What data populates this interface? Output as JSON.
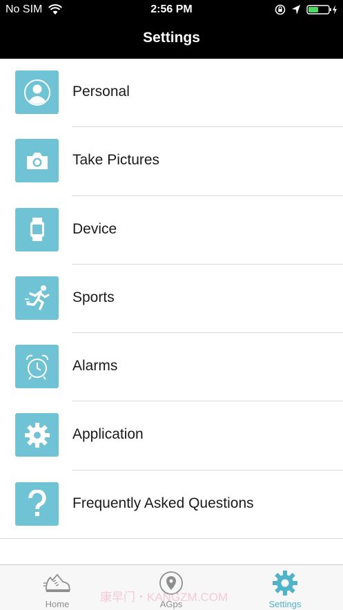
{
  "status_bar": {
    "carrier": "No SIM",
    "time": "2:56 PM"
  },
  "nav": {
    "title": "Settings"
  },
  "items": [
    {
      "label": "Personal",
      "icon": "person-icon"
    },
    {
      "label": "Take Pictures",
      "icon": "camera-icon"
    },
    {
      "label": "Device",
      "icon": "watch-icon"
    },
    {
      "label": "Sports",
      "icon": "running-icon"
    },
    {
      "label": "Alarms",
      "icon": "alarm-clock-icon"
    },
    {
      "label": "Application",
      "icon": "gear-icon"
    },
    {
      "label": "Frequently Asked Questions",
      "icon": "question-mark-icon"
    }
  ],
  "tabs": [
    {
      "label": "Home",
      "icon": "shoe-icon",
      "active": false
    },
    {
      "label": "AGps",
      "icon": "location-pin-icon",
      "active": false
    },
    {
      "label": "Settings",
      "icon": "gear-icon",
      "active": true
    }
  ],
  "watermark": "康早门・KANGZM.COM",
  "colors": {
    "accent": "#6fc3d4",
    "active_tab": "#4fb3cb",
    "top_bar": "#000000"
  }
}
